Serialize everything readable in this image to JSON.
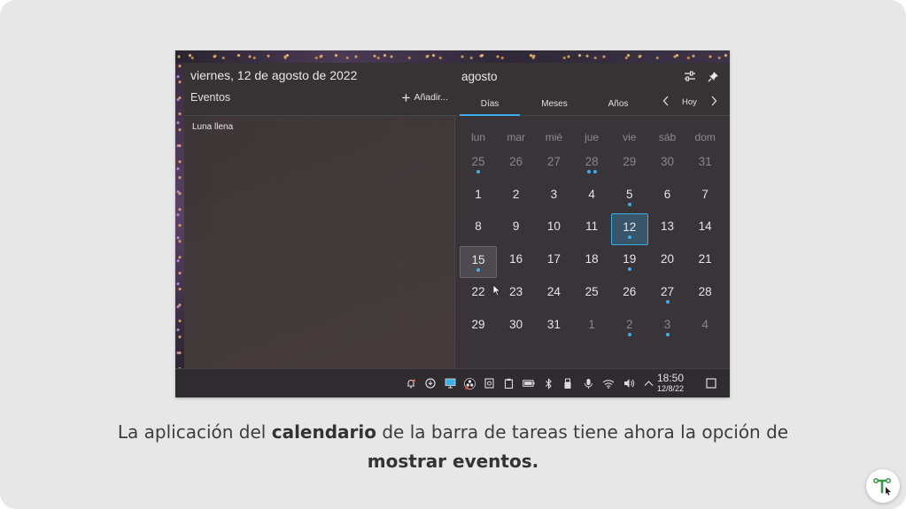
{
  "calendar_widget": {
    "date_title": "viernes, 12 de agosto de 2022",
    "events_label": "Eventos",
    "add_label": "Añadir...",
    "events": [
      "Luna llena"
    ],
    "month_title": "agosto",
    "tabs": [
      "Días",
      "Meses",
      "Años"
    ],
    "active_tab": "Días",
    "today_label": "Hoy",
    "weekdays": [
      "lun",
      "mar",
      "mié",
      "jue",
      "vie",
      "sáb",
      "dom"
    ],
    "weeks": [
      [
        {
          "d": "25",
          "dim": true,
          "dots": 1
        },
        {
          "d": "26",
          "dim": true,
          "dots": 0
        },
        {
          "d": "27",
          "dim": true,
          "dots": 0
        },
        {
          "d": "28",
          "dim": true,
          "dots": 2
        },
        {
          "d": "29",
          "dim": true,
          "dots": 0
        },
        {
          "d": "30",
          "dim": true,
          "dots": 0
        },
        {
          "d": "31",
          "dim": true,
          "dots": 0
        }
      ],
      [
        {
          "d": "1",
          "dots": 0
        },
        {
          "d": "2",
          "dots": 0
        },
        {
          "d": "3",
          "dots": 0
        },
        {
          "d": "4",
          "dots": 0
        },
        {
          "d": "5",
          "dots": 1
        },
        {
          "d": "6",
          "dots": 0
        },
        {
          "d": "7",
          "dots": 0
        }
      ],
      [
        {
          "d": "8",
          "dots": 0
        },
        {
          "d": "9",
          "dots": 0
        },
        {
          "d": "10",
          "dots": 0
        },
        {
          "d": "11",
          "dots": 0
        },
        {
          "d": "12",
          "dots": 1,
          "today": true
        },
        {
          "d": "13",
          "dots": 0
        },
        {
          "d": "14",
          "dots": 0
        }
      ],
      [
        {
          "d": "15",
          "dots": 1,
          "hover": true
        },
        {
          "d": "16",
          "dots": 0
        },
        {
          "d": "17",
          "dots": 0
        },
        {
          "d": "18",
          "dots": 0
        },
        {
          "d": "19",
          "dots": 1
        },
        {
          "d": "20",
          "dots": 0
        },
        {
          "d": "21",
          "dots": 0
        }
      ],
      [
        {
          "d": "22",
          "dots": 0
        },
        {
          "d": "23",
          "dots": 0
        },
        {
          "d": "24",
          "dots": 0
        },
        {
          "d": "25",
          "dots": 0
        },
        {
          "d": "26",
          "dots": 0
        },
        {
          "d": "27",
          "dots": 1
        },
        {
          "d": "28",
          "dots": 0
        }
      ],
      [
        {
          "d": "29",
          "dots": 0
        },
        {
          "d": "30",
          "dots": 0
        },
        {
          "d": "31",
          "dots": 0
        },
        {
          "d": "1",
          "dim": true,
          "dots": 0
        },
        {
          "d": "2",
          "dim": true,
          "dots": 1
        },
        {
          "d": "3",
          "dim": true,
          "dots": 1
        },
        {
          "d": "4",
          "dim": true,
          "dots": 0
        }
      ]
    ],
    "accent_color": "#3daee9"
  },
  "taskbar": {
    "tray_icons": [
      "notification-bell-icon",
      "update-icon",
      "display-icon",
      "obs-icon",
      "storage-icon",
      "clipboard-icon",
      "battery-icon",
      "bluetooth-icon",
      "usb-icon",
      "microphone-icon",
      "wifi-icon",
      "volume-icon",
      "expand-tray-icon"
    ],
    "clock_time": "18:50",
    "clock_date": "12/8/22"
  },
  "caption": {
    "part1": "La aplicación del ",
    "bold1": "calendario",
    "part2": " de la barra de tareas tiene ahora la opción de",
    "bold2": "mostrar eventos."
  }
}
